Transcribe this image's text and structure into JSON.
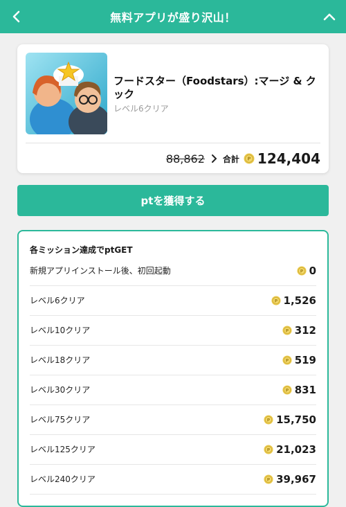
{
  "header": {
    "title": "無料アプリが盛り沢山！",
    "back_icon": "chevron-left-icon",
    "collapse_icon": "chevron-up-icon"
  },
  "app": {
    "name": "フードスター（Foodstars）:マージ & クック",
    "status": "レベル6クリア",
    "old_points": "88,862",
    "total_label": "合計",
    "total_points": "124,404"
  },
  "action": {
    "label": "ptを獲得する"
  },
  "missions": {
    "title": "各ミッション達成でptGET",
    "items": [
      {
        "label": "新規アプリインストール後、初回起動",
        "points": "0"
      },
      {
        "label": "レベル6クリア",
        "points": "1,526"
      },
      {
        "label": "レベル10クリア",
        "points": "312"
      },
      {
        "label": "レベル18クリア",
        "points": "519"
      },
      {
        "label": "レベル30クリア",
        "points": "831"
      },
      {
        "label": "レベル75クリア",
        "points": "15,750"
      },
      {
        "label": "レベル125クリア",
        "points": "21,023"
      },
      {
        "label": "レベル240クリア",
        "points": "39,967"
      }
    ]
  },
  "colors": {
    "accent": "#2bb89a",
    "coin": "#e9c84a",
    "background": "#f0f0f0"
  }
}
